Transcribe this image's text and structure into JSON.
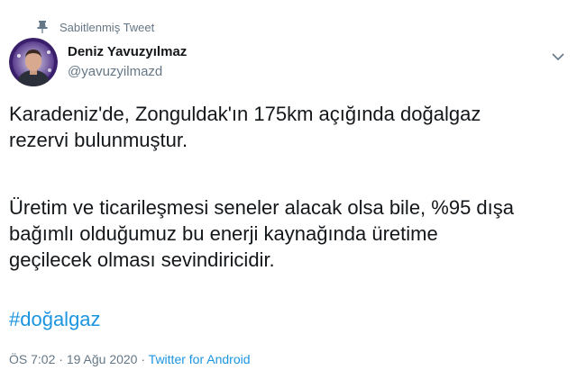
{
  "pinned_label": "Sabitlenmiş Tweet",
  "user": {
    "name": "Deniz Yavuzyılmaz",
    "handle": "@yavuzyilmazd"
  },
  "tweet": {
    "line1": "Karadeniz'de, Zonguldak'ın 175km açığında doğalgaz",
    "line2": "rezervi bulunmuştur.",
    "line3": "Üretim ve ticarileşmesi seneler alacak olsa bile, %95 dışa",
    "line4": "bağımlı olduğumuz bu enerji kaynağında üretime",
    "line5": "geçilecek olması sevindiricidir.",
    "hashtag": "#doğalgaz"
  },
  "meta": {
    "time": "ÖS 7:02",
    "separator": "·",
    "date": "19 Ağu 2020",
    "source": "Twitter for Android"
  },
  "colors": {
    "link": "#1b95e0",
    "secondary": "#657786",
    "text": "#14171a"
  },
  "icons": {
    "pin": "pin-icon",
    "caret": "chevron-down-icon"
  }
}
